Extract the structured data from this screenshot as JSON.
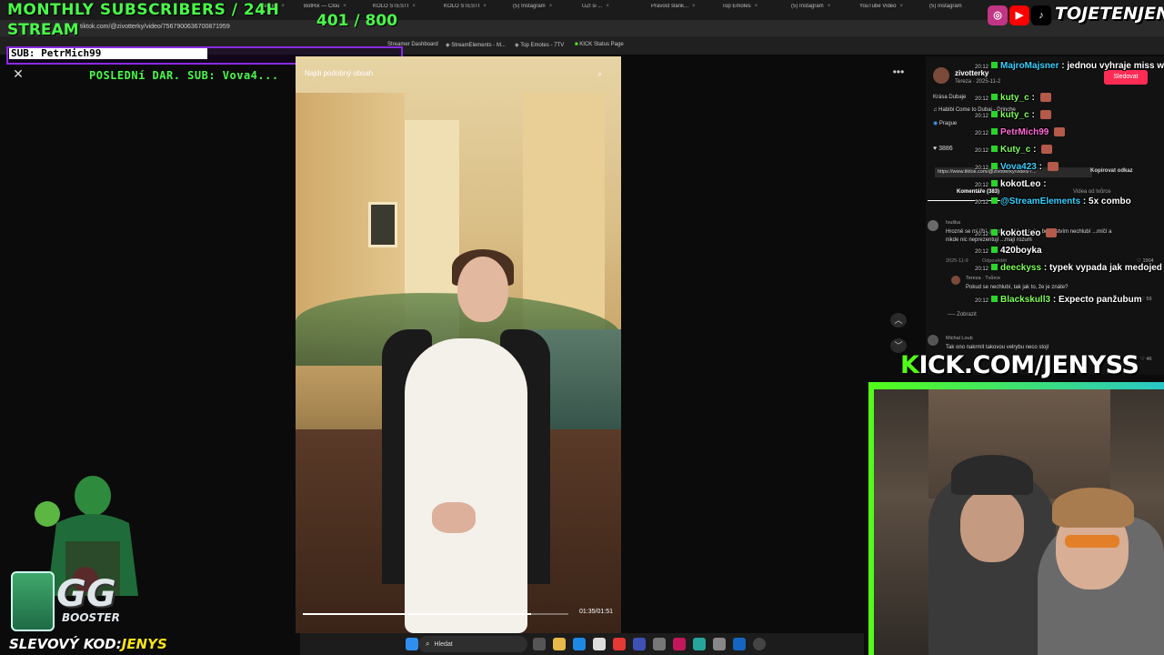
{
  "browser": {
    "tabs": [
      {
        "label": "Elemen"
      },
      {
        "label": "BotRix — Clou"
      },
      {
        "label": "KOLO ŠTĚSTÍ"
      },
      {
        "label": "KOLO ŠTĚSTÍ"
      },
      {
        "label": "(5) Instagram"
      },
      {
        "label": "UZI si ..."
      },
      {
        "label": "Pravost šlánk..."
      },
      {
        "label": "Top Emotes"
      },
      {
        "label": "(5) Instagram"
      },
      {
        "label": "YouTube Video"
      },
      {
        "label": "(5) Instagram"
      }
    ],
    "url": "tiktok.com/@zivotterky/video/7567900636700871959",
    "bookmarks": [
      {
        "label": "Streamer Dashboard"
      },
      {
        "label": "StreamElements - M..."
      },
      {
        "label": "Top Emotes - 7TV"
      },
      {
        "label": "KICK Status Page"
      }
    ]
  },
  "overlay": {
    "monthly_title": "MONTHLY SUBSCRIBERS / 24H",
    "stream_word": "STREAM",
    "goal": "401 / 800",
    "sub_alert": "SUB: PetrMich99",
    "last_donor": "POSLEDNí DAR. SUB: Vova4..."
  },
  "tiktok": {
    "similar": "Najdi podobný obsah",
    "time": "01:35/01:51",
    "progress": 0.86,
    "author": "zivotterky",
    "author_sub": "Tereza · 2025-11-2",
    "caption": "Krása Dubaje",
    "music": "Habibi Come to Dubai - Drinche",
    "location": "Prague",
    "likes": "3886",
    "link": "https://www.tiktok.com/@zivotterky/video/7...",
    "copy_link": "Kopírovat odkaz",
    "follow": "Sledovat",
    "comments_tab": "Komentáře (383)",
    "creator_videos": "Videa od tvůrce",
    "comments": [
      {
        "user": "Ivuška",
        "text": "Hrozně se mi líbí, jak se nechlubí svým bohatstvím nechlubí ...míčí a nikde nic neprezentují ...mají rozum",
        "date": "2025-11-9",
        "reply": "Odpovědět",
        "likes": "1904"
      },
      {
        "user": "Tereza · Tvůrce",
        "text": "Pokud se nechlubí, tak jak to, že je znáte?",
        "likes": "59"
      },
      {
        "user": "Michal Loub",
        "text": "Tak ono nakrmit takovou velrybu neco stojí",
        "likes": "46"
      }
    ],
    "show_more": "Zobrazit"
  },
  "chat": [
    {
      "time": "20:12",
      "user": "MajroMajsner",
      "text": "jednou vyhraje miss word"
    },
    {
      "time": "20:12",
      "user": "kuty_c",
      "text": ""
    },
    {
      "time": "20:12",
      "user": "kuty_c",
      "text": ""
    },
    {
      "time": "20:12",
      "user": "PetrMich99",
      "text": ""
    },
    {
      "time": "20:12",
      "user": "Kuty_c",
      "text": ""
    },
    {
      "time": "20:12",
      "user": "Vova423",
      "text": ""
    },
    {
      "time": "20:12",
      "user": "kokotLeo",
      "text": ""
    },
    {
      "time": "20:12",
      "user": "@StreamElements",
      "text": "5x combo"
    },
    {
      "time": "20:12",
      "user": "kokotLeo",
      "text": ""
    },
    {
      "time": "20:12",
      "user": "420boyka",
      "text": ""
    },
    {
      "time": "20:12",
      "user": "deeckyss",
      "text": "typek vypada jak medojed"
    },
    {
      "time": "20:12",
      "user": "Blackskull3",
      "text": "Expecto panžubum"
    }
  ],
  "socials": {
    "handle": "TOJETENJENYS",
    "icons": [
      "instagram-icon",
      "youtube-icon",
      "tiktok-icon"
    ]
  },
  "webcam": {
    "kick_prefix": "K",
    "kick_rest": "ICK.COM/JENYSS"
  },
  "promo": {
    "label": "SLEVOVÝ KOD:",
    "code": "JENYS"
  },
  "booster": {
    "big": "GG",
    "small": "BOOSTER"
  },
  "taskbar": {
    "search": "Hledat"
  },
  "colors": {
    "accent_green": "#4af94a",
    "kick_green": "#53fc18",
    "tiktok_red": "#fe2c55",
    "sub_border": "#8a2be2"
  }
}
